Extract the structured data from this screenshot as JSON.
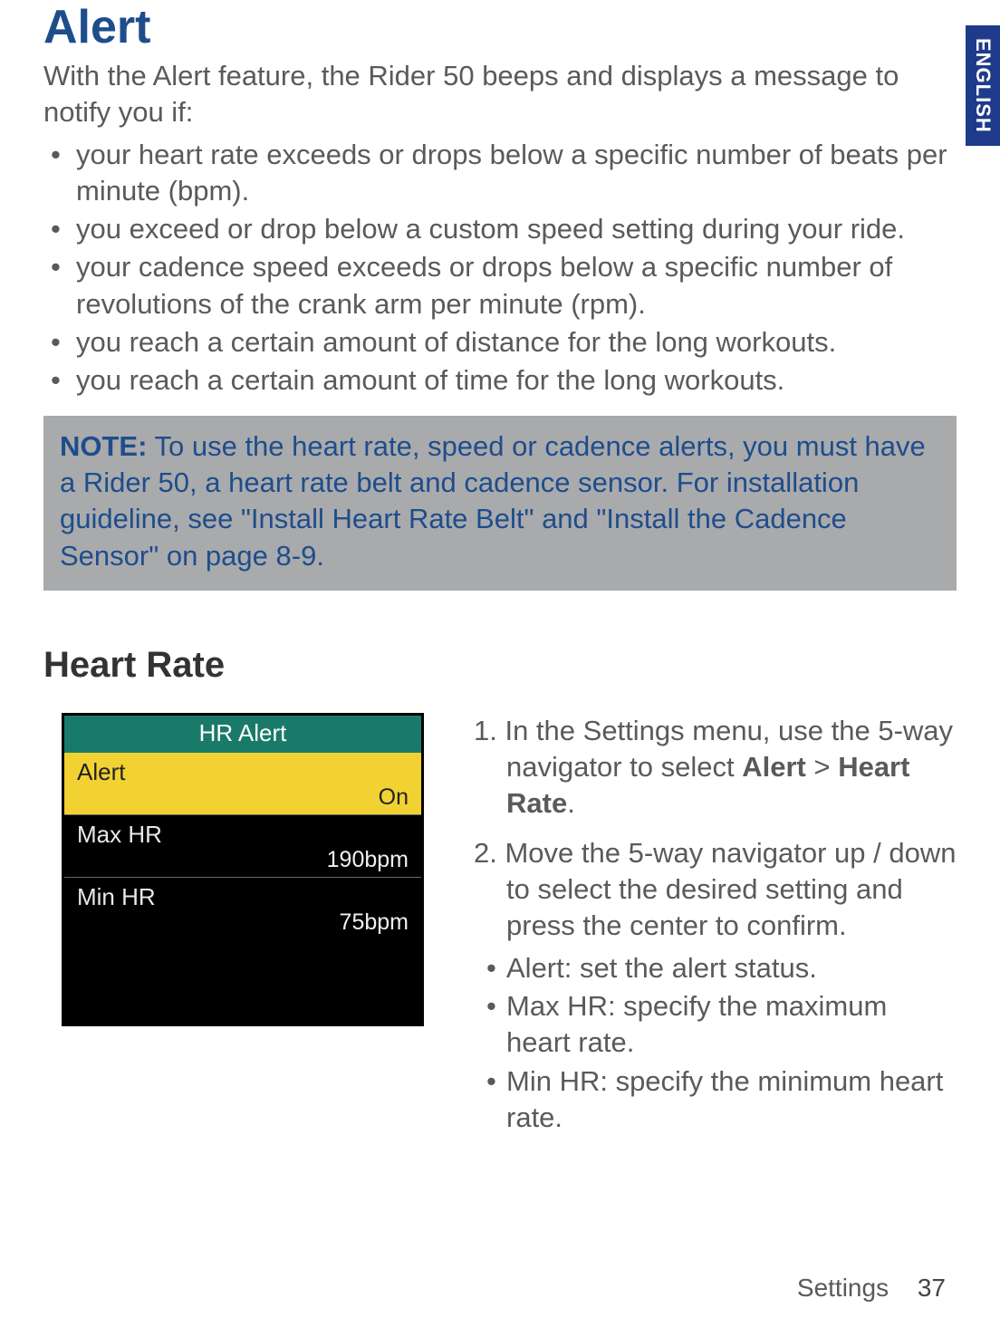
{
  "lang_tab": "ENGLISH",
  "title": "Alert",
  "intro": "With the Alert feature, the Rider 50 beeps and displays a message to notify you if:",
  "bullets": [
    "your heart rate exceeds or drops below a specific number of beats per minute (bpm).",
    "you exceed or drop below a custom speed setting during your ride.",
    "your cadence speed exceeds or drops below a specific number of revolutions of the crank arm per minute (rpm).",
    "you reach a certain amount of distance for the long workouts.",
    "you reach a certain amount of time for the long workouts."
  ],
  "note": {
    "label": "NOTE:",
    "text": "To use the heart rate, speed or cadence alerts, you must have a Rider 50, a heart rate belt and cadence sensor. For installation guideline, see \"Install Heart Rate Belt\" and \"Install the Cadence Sensor\" on page 8-9."
  },
  "subheading": "Heart Rate",
  "screen": {
    "header": "HR Alert",
    "rows": [
      {
        "label": "Alert",
        "value": "On",
        "selected": true
      },
      {
        "label": "Max HR",
        "value": "190bpm",
        "selected": false
      },
      {
        "label": "Min HR",
        "value": "75bpm",
        "selected": false
      }
    ]
  },
  "steps": {
    "s1_pre": "1. In the Settings menu, use the 5-way navigator to select ",
    "s1_bold1": "Alert",
    "s1_mid": " > ",
    "s1_bold2": "Heart Rate",
    "s1_post": ".",
    "s2": "2. Move the 5-way navigator up / down to select the desired setting and press the center to confirm.",
    "sub": [
      "Alert: set the alert status.",
      "Max HR: specify the maximum heart rate.",
      "Min HR: specify the minimum heart rate."
    ]
  },
  "footer": {
    "section": "Settings",
    "page": "37"
  }
}
